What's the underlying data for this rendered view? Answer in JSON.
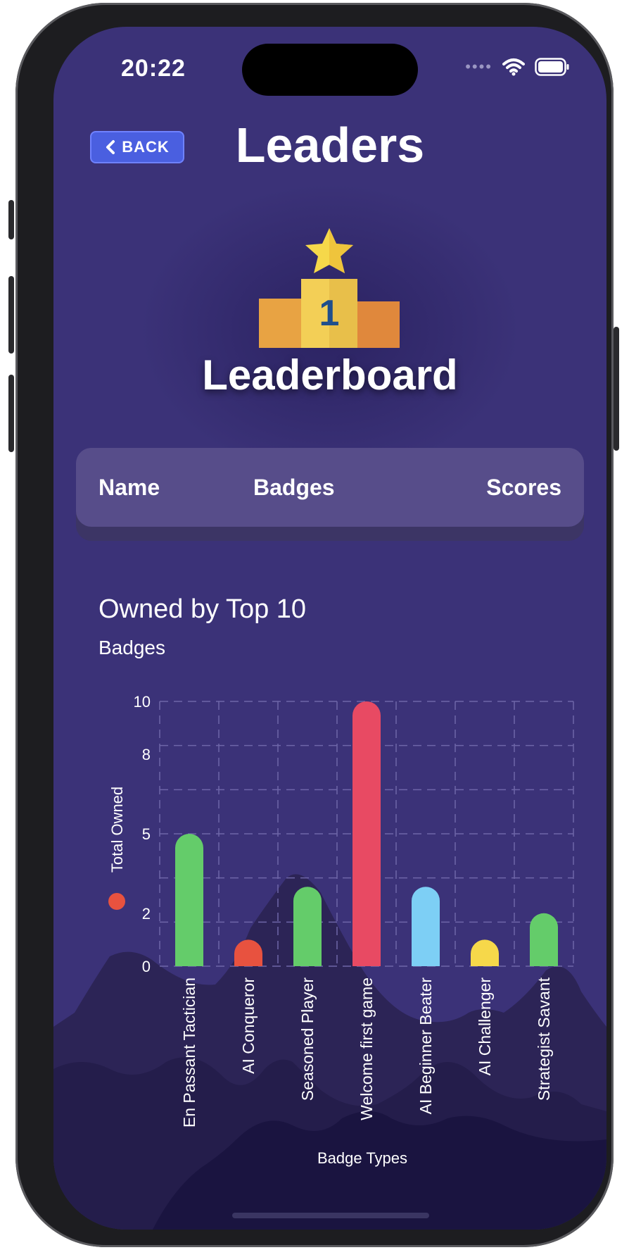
{
  "status_bar": {
    "time": "20:22"
  },
  "header": {
    "back_label": "BACK",
    "title": "Leaders"
  },
  "hero": {
    "title": "Leaderboard",
    "podium_number": "1"
  },
  "table": {
    "columns": [
      "Name",
      "Badges",
      "Scores"
    ]
  },
  "chart_section": {
    "title": "Owned by Top 10",
    "subtitle": "Badges"
  },
  "colors": {
    "background": "#3b3278",
    "back_button": "#4a5fe0",
    "header_panel": "#574d8a"
  },
  "chart_data": {
    "type": "bar",
    "categories": [
      "En Passant Tactician",
      "AI Conqueror",
      "Seasoned Player",
      "Welcome first game",
      "AI Beginner Beater",
      "AI Challenger",
      "Strategist Savant"
    ],
    "series": [
      {
        "values": [
          5,
          1,
          3,
          10,
          3,
          1,
          2
        ]
      }
    ],
    "bar_colors": [
      "#64cc6a",
      "#e8523f",
      "#64cc6a",
      "#e84a63",
      "#7dcff5",
      "#f6d84a",
      "#64cc6a"
    ],
    "xlabel": "Badge Types",
    "ylabel": "Total Owned",
    "ylim": [
      0,
      10
    ],
    "yticks": [
      "0",
      "2",
      "5",
      "8",
      "10"
    ],
    "grid": true,
    "legend": "left"
  }
}
